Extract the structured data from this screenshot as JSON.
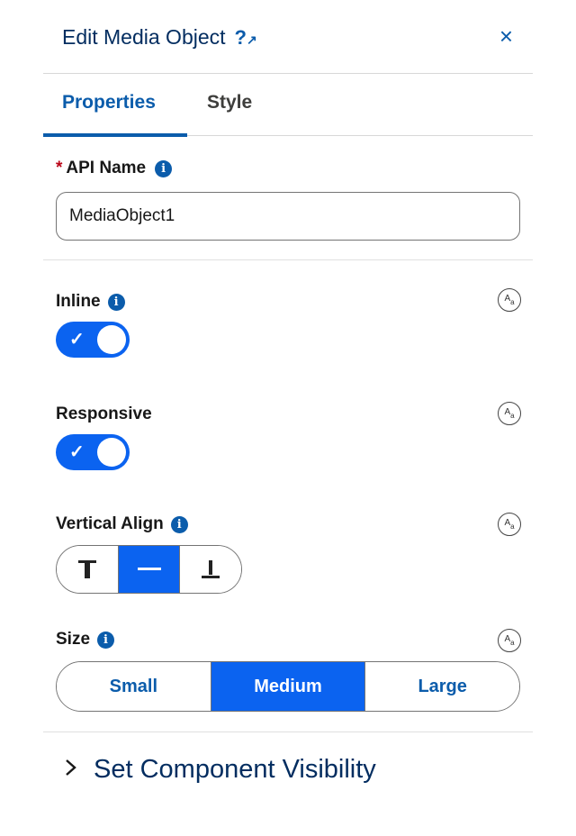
{
  "header": {
    "title": "Edit Media Object",
    "help_icon": "help-icon",
    "close_icon": "close-icon"
  },
  "tabs": [
    {
      "label": "Properties",
      "active": true
    },
    {
      "label": "Style",
      "active": false
    }
  ],
  "api_name": {
    "required_marker": "*",
    "label": "API Name",
    "value": "MediaObject1"
  },
  "inline": {
    "label": "Inline",
    "checked": true,
    "check_glyph": "✓"
  },
  "responsive": {
    "label": "Responsive",
    "checked": true,
    "check_glyph": "✓"
  },
  "vertical_align": {
    "label": "Vertical Align",
    "options": [
      "top",
      "center",
      "bottom"
    ],
    "selected": "center"
  },
  "size": {
    "label": "Size",
    "options": [
      "Small",
      "Medium",
      "Large"
    ],
    "selected": "Medium"
  },
  "visibility": {
    "label": "Set Component Visibility",
    "chevron": "›"
  },
  "icons": {
    "info": "i",
    "close": "×",
    "help": "?↗"
  },
  "colors": {
    "accent": "#0b63f0",
    "brand_text": "#0b5cab",
    "title": "#032d60",
    "required": "#ba0517"
  }
}
